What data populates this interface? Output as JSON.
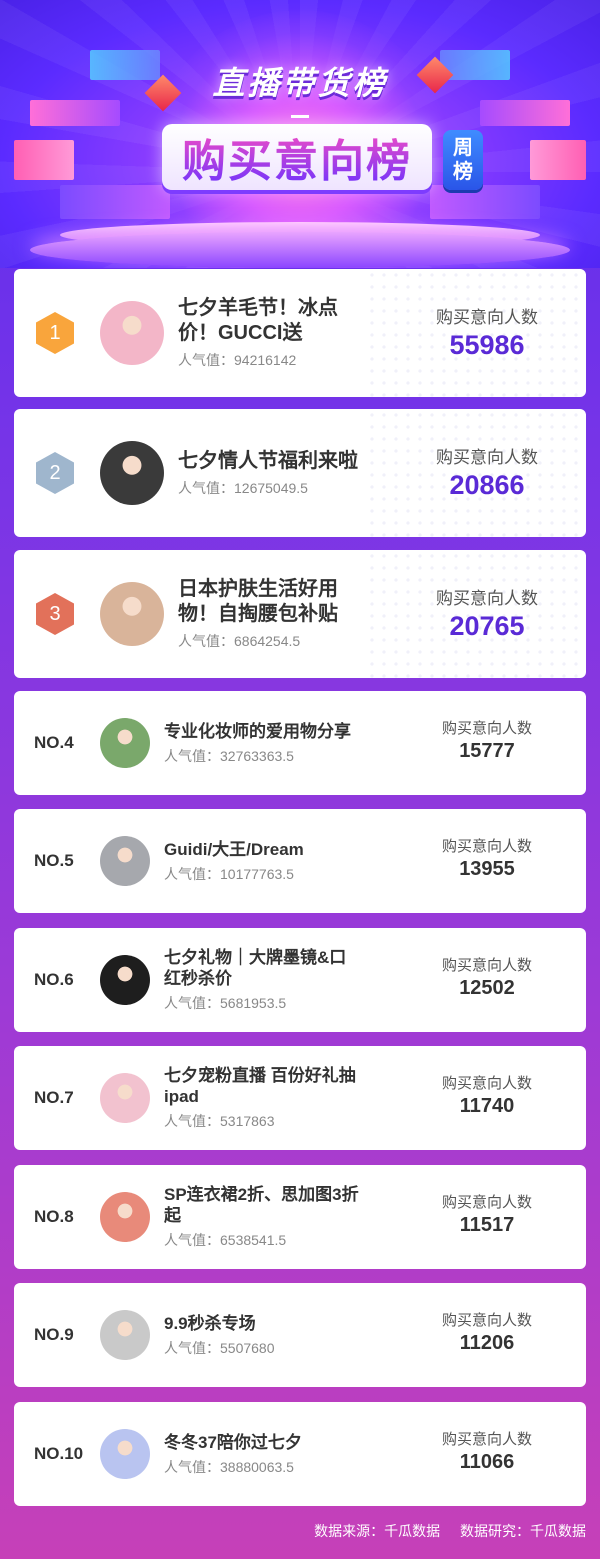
{
  "header": {
    "title_top": "直播带货榜",
    "title_main": "购买意向榜",
    "badge": [
      "周",
      "榜"
    ]
  },
  "items": [
    {
      "rank": "1",
      "name_lines": [
        "七夕羊毛节！冰点",
        "价！GUCCI送"
      ],
      "popularity": "人气值：94216142",
      "metric_label": "购买意向人数",
      "metric_value": "55986",
      "badge_color": "#f9a53c",
      "avatar_color": "#f3b6c8"
    },
    {
      "rank": "2",
      "name_lines": [
        "七夕情人节福利来啦"
      ],
      "popularity": "人气值：12675049.5",
      "metric_label": "购买意向人数",
      "metric_value": "20866",
      "badge_color": "#9fb6cd",
      "avatar_color": "#3a3a3a"
    },
    {
      "rank": "3",
      "name_lines": [
        "日本护肤生活好用",
        "物！自掏腰包补贴"
      ],
      "popularity": "人气值：6864254.5",
      "metric_label": "购买意向人数",
      "metric_value": "20765",
      "badge_color": "#e2715a",
      "avatar_color": "#d9b49a"
    },
    {
      "rank": "NO.4",
      "name_lines": [
        "专业化妆师的爱用物分享"
      ],
      "popularity": "人气值：32763363.5",
      "metric_label": "购买意向人数",
      "metric_value": "15777",
      "avatar_color": "#7aa86b"
    },
    {
      "rank": "NO.5",
      "name_lines": [
        "Guidi/大王/Dream"
      ],
      "popularity": "人气值：10177763.5",
      "metric_label": "购买意向人数",
      "metric_value": "13955",
      "avatar_color": "#a6a8ad"
    },
    {
      "rank": "NO.6",
      "name_lines": [
        "七夕礼物｜大牌墨镜&口",
        "红秒杀价"
      ],
      "popularity": "人气值：5681953.5",
      "metric_label": "购买意向人数",
      "metric_value": "12502",
      "avatar_color": "#1e1e1e"
    },
    {
      "rank": "NO.7",
      "name_lines": [
        "七夕宠粉直播 百份好礼抽",
        "ipad"
      ],
      "popularity": "人气值：5317863",
      "metric_label": "购买意向人数",
      "metric_value": "11740",
      "avatar_color": "#f2c2cf"
    },
    {
      "rank": "NO.8",
      "name_lines": [
        "SP连衣裙2折、思加图3折",
        "起"
      ],
      "popularity": "人气值：6538541.5",
      "metric_label": "购买意向人数",
      "metric_value": "11517",
      "avatar_color": "#e88a7a"
    },
    {
      "rank": "NO.9",
      "name_lines": [
        "9.9秒杀专场"
      ],
      "popularity": "人气值：5507680",
      "metric_label": "购买意向人数",
      "metric_value": "11206",
      "avatar_color": "#c9c9c9"
    },
    {
      "rank": "NO.10",
      "name_lines": [
        "冬冬37陪你过七夕"
      ],
      "popularity": "人气值：38880063.5",
      "metric_label": "购买意向人数",
      "metric_value": "11066",
      "avatar_color": "#b9c4f0"
    }
  ],
  "footer": {
    "source": "数据来源：千瓜数据",
    "research": "数据研究：千瓜数据"
  },
  "colors": {
    "accent_number": "#5a2ad6",
    "normal_number": "#333333"
  }
}
